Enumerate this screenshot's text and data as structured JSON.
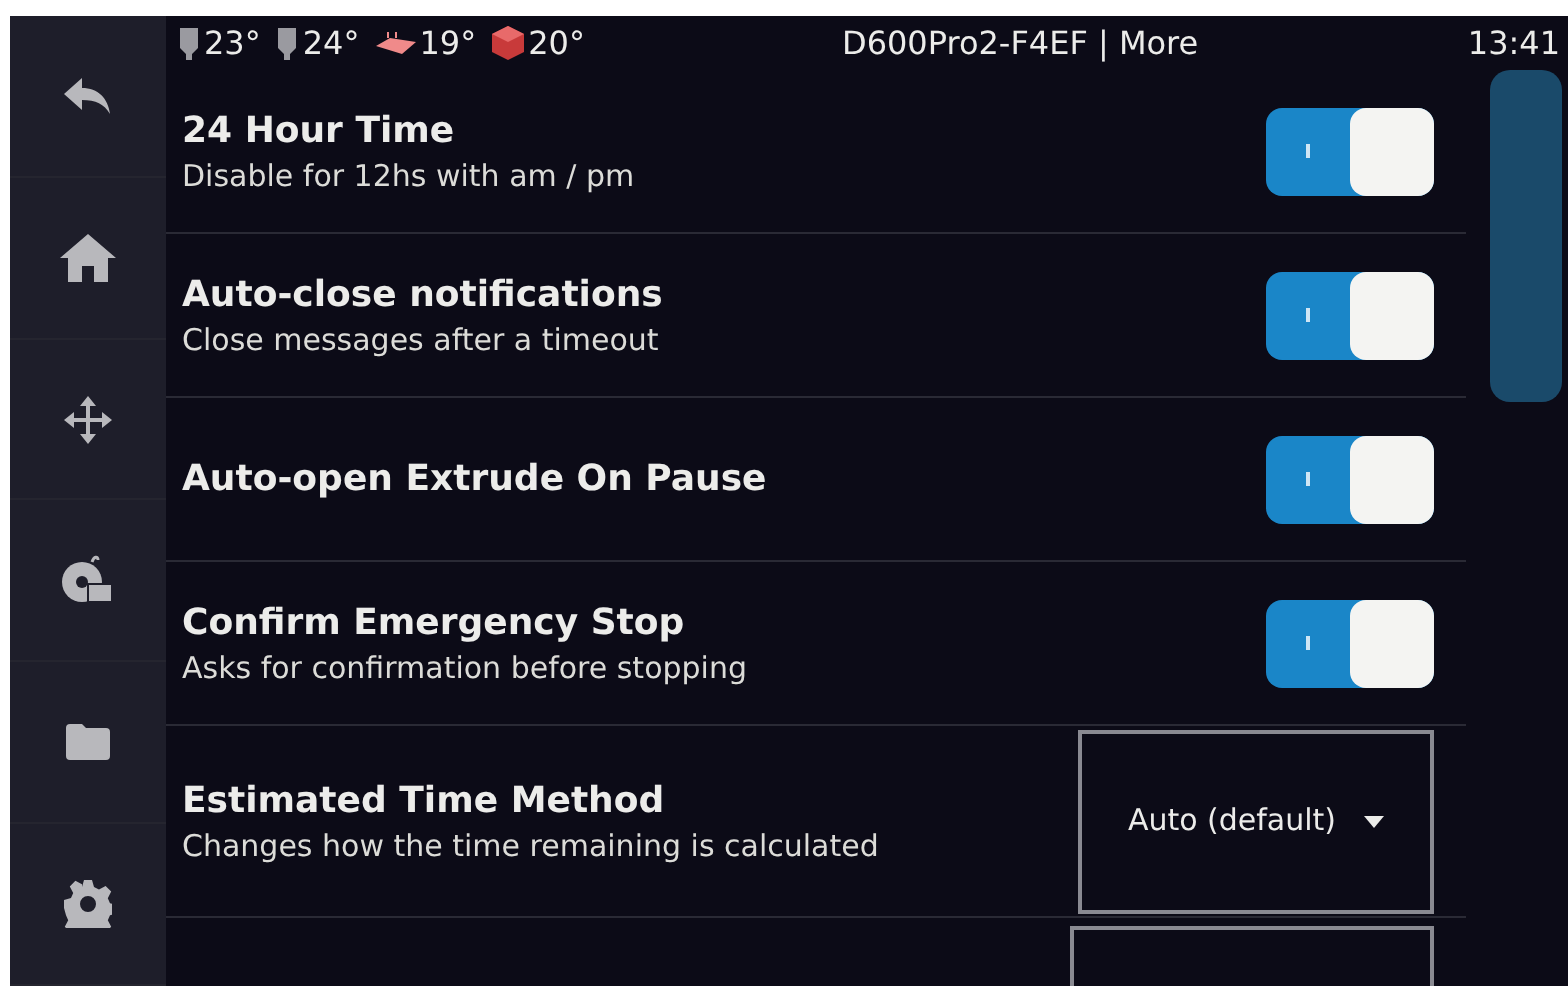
{
  "status_bar": {
    "temperatures": [
      {
        "kind": "nozzle",
        "value": "23°"
      },
      {
        "kind": "nozzle",
        "value": "24°"
      },
      {
        "kind": "bed",
        "value": "19°"
      },
      {
        "kind": "chamber",
        "value": "20°"
      }
    ],
    "title": "D600Pro2-F4EF | More",
    "time": "13:41"
  },
  "sidebar": {
    "items": [
      {
        "kind": "back"
      },
      {
        "kind": "home"
      },
      {
        "kind": "move"
      },
      {
        "kind": "extrude"
      },
      {
        "kind": "files"
      },
      {
        "kind": "settings"
      }
    ]
  },
  "settings": [
    {
      "kind": "toggle",
      "title": "24 Hour Time",
      "description": "Disable for 12hs with am / pm",
      "on": true
    },
    {
      "kind": "toggle",
      "title": "Auto-close notifications",
      "description": "Close messages after a timeout",
      "on": true
    },
    {
      "kind": "toggle",
      "title": "Auto-open Extrude On Pause",
      "on": true
    },
    {
      "kind": "toggle",
      "title": "Confirm Emergency Stop",
      "description": "Asks for confirmation before stopping",
      "on": true
    },
    {
      "kind": "dropdown",
      "title": "Estimated Time Method",
      "description": "Changes how the time remaining is calculated",
      "value": "Auto (default)"
    }
  ]
}
